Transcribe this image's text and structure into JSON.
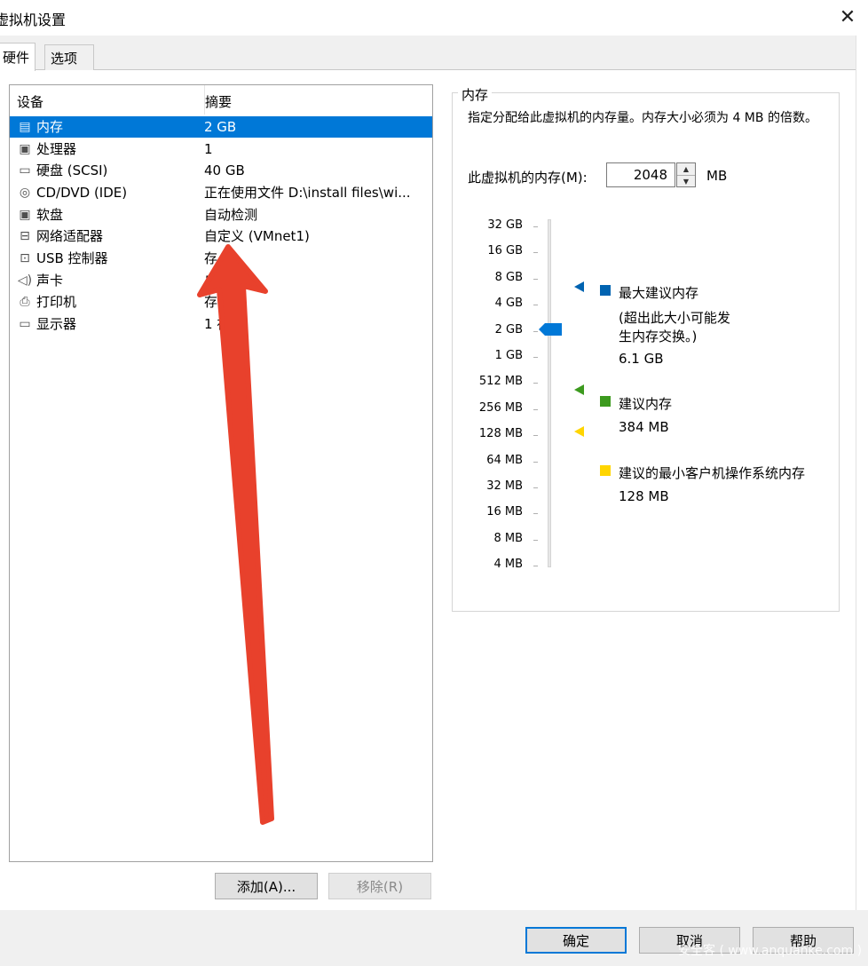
{
  "window": {
    "title": "虚拟机设置"
  },
  "tabs": [
    {
      "label": "硬件"
    },
    {
      "label": "选项"
    }
  ],
  "device_table": {
    "headers": {
      "device": "设备",
      "summary": "摘要"
    },
    "rows": [
      {
        "name": "内存",
        "summary": "2 GB",
        "icon": "memory-icon",
        "selected": true
      },
      {
        "name": "处理器",
        "summary": "1",
        "icon": "processor-icon"
      },
      {
        "name": "硬盘 (SCSI)",
        "summary": "40 GB",
        "icon": "harddisk-icon"
      },
      {
        "name": "CD/DVD (IDE)",
        "summary": "正在使用文件 D:\\install files\\wi...",
        "icon": "cd-dvd-icon"
      },
      {
        "name": "软盘",
        "summary": "自动检测",
        "icon": "floppy-icon"
      },
      {
        "name": "网络适配器",
        "summary": "自定义 (VMnet1)",
        "icon": "network-adapter-icon"
      },
      {
        "name": "USB 控制器",
        "summary": "存",
        "icon": "usb-icon"
      },
      {
        "name": "声卡",
        "summary": "自 测",
        "icon": "sound-icon"
      },
      {
        "name": "打印机",
        "summary": "存",
        "icon": "printer-icon"
      },
      {
        "name": "显示器",
        "summary": "1 视器",
        "icon": "monitor-icon"
      }
    ]
  },
  "buttons": {
    "add": "添加(A)...",
    "remove": "移除(R)",
    "ok": "确定",
    "cancel": "取消",
    "help": "帮助"
  },
  "memory": {
    "group_title": "内存",
    "description": "指定分配给此虚拟机的内存量。内存大小必须为 4 MB 的倍数。",
    "input_label": "此虚拟机的内存(M):",
    "value": "2048",
    "unit": "MB",
    "scale_labels": [
      "32 GB",
      "16 GB",
      "8 GB",
      "4 GB",
      "2 GB",
      "1 GB",
      "512 MB",
      "256 MB",
      "128 MB",
      "64 MB",
      "32 MB",
      "16 MB",
      "8 MB",
      "4 MB"
    ],
    "current_level": "2 GB",
    "legend": {
      "max_title": "最大建议内存",
      "max_note": "(超出此大小可能发生内存交换。)",
      "max_value": "6.1 GB",
      "rec_title": "建议内存",
      "rec_value": "384 MB",
      "min_title": "建议的最小客户机操作系统内存",
      "min_value": "128 MB"
    },
    "colors": {
      "max": "#0063b1",
      "recommended": "#3c9a1e",
      "minimum": "#ffd500",
      "thumb": "#0078d7"
    }
  },
  "annotation": {
    "arrow_color": "#e8412c"
  },
  "watermark": "安全客 ( www.anquanke.com )"
}
